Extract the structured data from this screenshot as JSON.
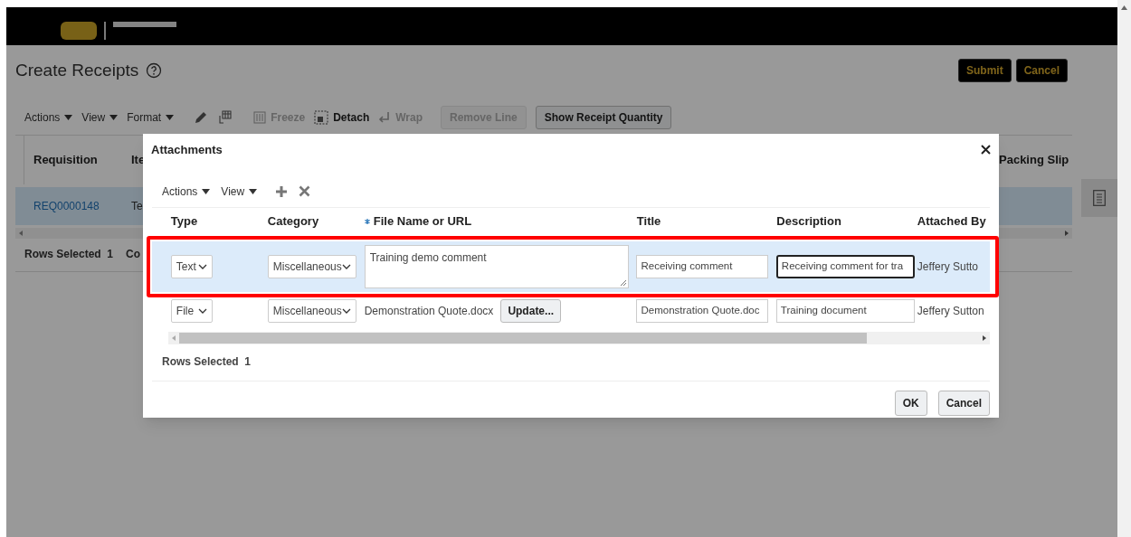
{
  "page": {
    "title": "Create Receipts",
    "header_buttons": [
      "Submit",
      "Cancel"
    ],
    "menus": [
      "Actions",
      "View",
      "Format"
    ],
    "tools": [
      {
        "label": "Freeze",
        "disabled": true
      },
      {
        "label": "Detach",
        "disabled": false
      },
      {
        "label": "Wrap",
        "disabled": true
      }
    ],
    "buttons": [
      {
        "label": "Remove Line",
        "disabled": true
      },
      {
        "label": "Show Receipt Quantity",
        "disabled": false
      }
    ],
    "table": {
      "columns": [
        "Requisition",
        "Ite",
        "Packing Slip"
      ],
      "rows": [
        {
          "selected": true,
          "cells": [
            "REQ0000148",
            "Te"
          ]
        }
      ]
    },
    "rows_selected": {
      "label": "Rows Selected",
      "value": "1"
    },
    "footer_fragment": "Co"
  },
  "dialog": {
    "title": "Attachments",
    "menus": [
      "Actions",
      "View"
    ],
    "columns": [
      {
        "label": "Type",
        "required": false
      },
      {
        "label": "Category",
        "required": false
      },
      {
        "label": "File Name or URL",
        "required": true
      },
      {
        "label": "Title",
        "required": false
      },
      {
        "label": "Description",
        "required": false
      },
      {
        "label": "Attached By",
        "required": false
      }
    ],
    "rows": [
      {
        "selected": true,
        "highlighted": true,
        "type": "Text",
        "category": "Miscellaneous",
        "file": {
          "kind": "textarea",
          "value": "Training demo comment"
        },
        "title": "Receiving comment",
        "description": "Receiving comment for tra",
        "focused": true,
        "attached_by": "Jeffery Sutto"
      },
      {
        "selected": false,
        "highlighted": false,
        "type": "File",
        "category": "Miscellaneous",
        "file": {
          "kind": "file",
          "value": "Demonstration Quote.docx",
          "button": "Update..."
        },
        "title": "Demonstration Quote.doc",
        "description": "Training document",
        "focused": false,
        "attached_by": "Jeffery Sutton"
      }
    ],
    "rows_selected": {
      "label": "Rows Selected",
      "value": "1"
    },
    "buttons": [
      "OK",
      "Cancel"
    ]
  }
}
